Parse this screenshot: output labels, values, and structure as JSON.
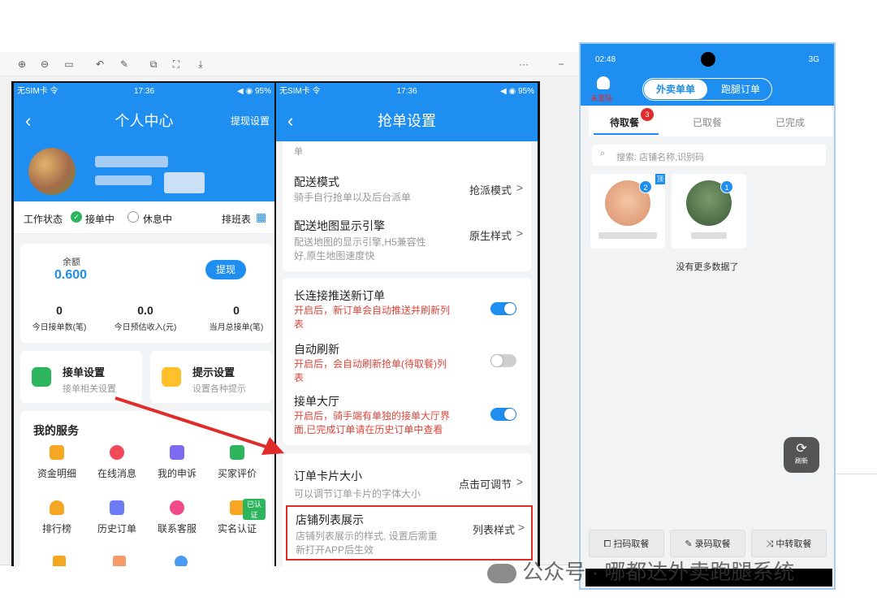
{
  "toolbar": {
    "more": "···",
    "minimize": "−"
  },
  "phone1": {
    "status_left": "无SIM卡 令",
    "time": "17:36",
    "status_right": "◀ ◉ 95%",
    "title": "个人中心",
    "header_action": "提现设置",
    "work_status_label": "工作状态",
    "status_active": "接单中",
    "status_rest": "休息中",
    "schedule": "排班表",
    "balance_label": "余额",
    "balance_value": "0.600",
    "withdraw": "提现",
    "stats": [
      {
        "value": "0",
        "label": "今日接单数(笔)"
      },
      {
        "value": "0.0",
        "label": "今日预估收入(元)"
      },
      {
        "value": "0",
        "label": "当月总接单(笔)"
      }
    ],
    "order_settings": {
      "title": "接单设置",
      "desc": "接单相关设置"
    },
    "tip_settings": {
      "title": "提示设置",
      "desc": "设置各种提示"
    },
    "services_title": "我的服务",
    "services": [
      "资金明细",
      "在线消息",
      "我的申诉",
      "买家评价",
      "排行榜",
      "历史订单",
      "联系客服",
      "实名认证"
    ],
    "verified_badge": "已认证"
  },
  "phone2": {
    "status_left": "无SIM卡 令",
    "time": "17:36",
    "status_right": "◀ ◉ 95%",
    "title": "抢单设置",
    "top_fragment": "单",
    "rows": {
      "delivery_mode": {
        "title": "配送模式",
        "desc": "骑手自行抢单以及后台派单",
        "value": "抢派模式"
      },
      "map_engine": {
        "title": "配送地图显示引擎",
        "desc1": "配送地图的显示引擎,H5兼容性",
        "desc2": "好,原生地图速度快",
        "value": "原生样式"
      },
      "long_conn": {
        "title": "长连接推送新订单",
        "desc1": "开启后，新订单会自动推送并刷新列",
        "desc2": "表",
        "on": true
      },
      "auto_refresh": {
        "title": "自动刷新",
        "desc1": "开启后，会自动刷新抢单(待取餐)列",
        "desc2": "表",
        "on": false
      },
      "hall": {
        "title": "接单大厅",
        "desc1": "开启后，骑手端有单独的接单大厅界",
        "desc2": "面,已完成订单请在历史订单中查看",
        "on": true
      },
      "card_size": {
        "title": "订单卡片大小",
        "desc": "可以调节订单卡片的字体大小",
        "value": "点击可调节"
      },
      "shop_list": {
        "title": "店铺列表展示",
        "desc1": "店铺列表展示的样式, 设置后需重",
        "desc2": "新打开APP后生效",
        "value": "列表样式"
      }
    },
    "chevron": ">"
  },
  "phone3": {
    "time": "02:48",
    "status_right": "3G",
    "user_status": "未登陆",
    "tabs_top": [
      "外卖单单",
      "跑腿订单"
    ],
    "tabs": [
      "待取餐",
      "已取餐",
      "已完成"
    ],
    "badge_count": "3",
    "search_placeholder": "搜索: 店铺名称,识别码",
    "shop_badges": [
      "2",
      "1"
    ],
    "pin_tag": "顶",
    "no_more": "没有更多数据了",
    "refresh": "刷新",
    "bottom_buttons": [
      "扫码取餐",
      "录码取餐",
      "中转取餐"
    ]
  },
  "watermark": "公众号 · 哪都达外卖跑腿系统",
  "colors": {
    "primary": "#1f8ef1",
    "annotation": "#e02b2b",
    "warning_text": "#e0453a"
  }
}
